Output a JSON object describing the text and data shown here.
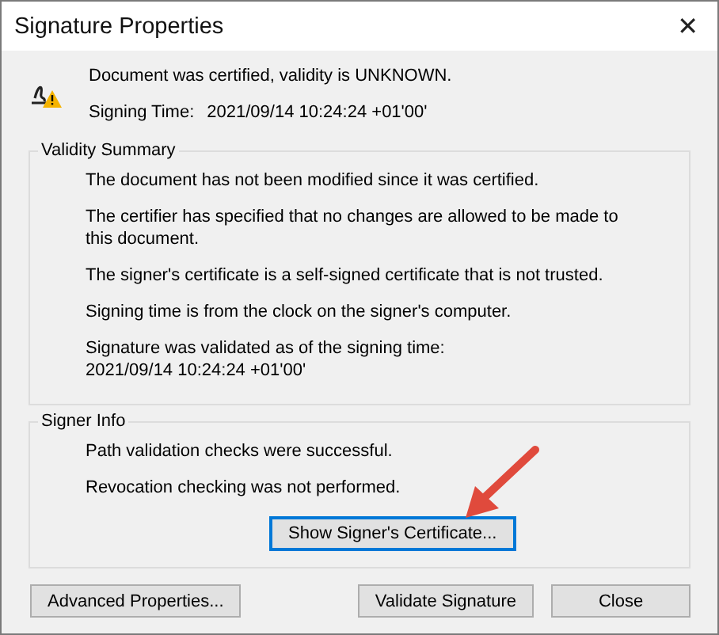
{
  "window": {
    "title": "Signature Properties",
    "close": "✕"
  },
  "header": {
    "status": "Document was certified, validity is UNKNOWN.",
    "signing_time_label": "Signing Time:",
    "signing_time": "2021/09/14 10:24:24 +01'00'"
  },
  "validity_summary": {
    "title": "Validity Summary",
    "messages": [
      "The document has not been modified since it was certified.",
      "The certifier has specified that no changes are allowed to be made to this document.",
      "The signer's certificate is a self-signed certificate that is not trusted.",
      "Signing time is from the clock on the signer's computer.",
      "Signature was validated as of the signing time:\n2021/09/14 10:24:24 +01'00'"
    ]
  },
  "signer_info": {
    "title": "Signer Info",
    "messages": [
      "Path validation checks were successful.",
      "Revocation checking was not performed."
    ],
    "button": {
      "label": "Show Signer's Certificate...",
      "focused": true
    }
  },
  "buttons": [
    {
      "label": "Advanced Properties...",
      "kind": "left"
    },
    {
      "label": "Validate Signature",
      "kind": "right"
    },
    {
      "label": "Close",
      "kind": "right"
    }
  ]
}
